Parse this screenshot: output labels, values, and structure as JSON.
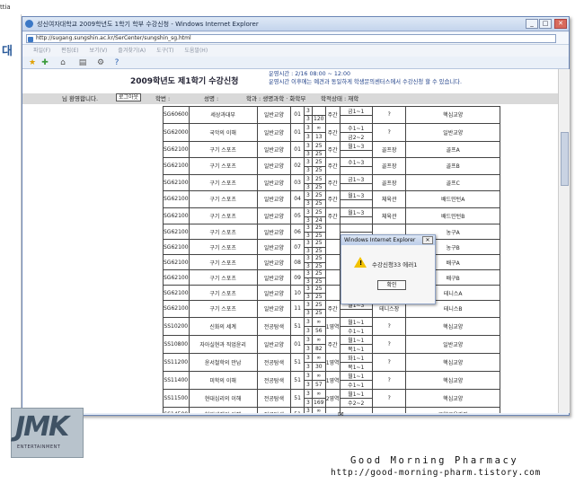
{
  "background_window": {
    "tab_fragment": "ttia",
    "side_char": "대"
  },
  "window": {
    "title": "성신여자대학교 2009학년도 1학기 학부 수강신청 - Windows Internet Explorer",
    "url": "http://sugang.sungshin.ac.kr/SerCenter/sungshin_sg.html",
    "menu": [
      "파일(F)",
      "편집(E)",
      "보기(V)",
      "즐겨찾기(A)",
      "도구(T)",
      "도움말(H)"
    ]
  },
  "page": {
    "title": "2009학년도 제1학기 수강신청",
    "info_line1": "운영시간 : 2/16 08:00 ~ 12:00",
    "info_line2": "운영시간 이후에는 예견과 동일하게 학생문의센터스에서 수강신청 할 수 있습니다.",
    "greeting": "님 환영합니다.",
    "logout": "로그아웃",
    "id_label": "학번 :",
    "name_label": "성명 :",
    "dept": "학과 : 생명과학 · 화학부",
    "status": "학적상태 : 재학"
  },
  "courses": [
    {
      "code": "SG60600",
      "name": "세상과대부",
      "type": "일반교양",
      "cls": "01",
      "nums": [
        "",
        "120"
      ],
      "day": "주간",
      "time": [
        "금1~1",
        ""
      ],
      "room": "?",
      "area": "핵심교양"
    },
    {
      "code": "SG62000",
      "name": "국악의 이해",
      "type": "일반교양",
      "cls": "01",
      "nums": [
        "∞",
        "13"
      ],
      "day": "주간",
      "time": [
        "수1~1",
        "금2~2"
      ],
      "room": "?",
      "area": "일반교양"
    },
    {
      "code": "SG62100",
      "name": "구기 스포츠",
      "type": "일반교양",
      "cls": "01",
      "nums": [
        "25",
        "25"
      ],
      "day": "주간",
      "time": [
        "월1~3",
        ""
      ],
      "room": "골프장",
      "area": "골프A"
    },
    {
      "code": "SG62100",
      "name": "구기 스포츠",
      "type": "일반교양",
      "cls": "02",
      "nums": [
        "25",
        "25"
      ],
      "day": "주간",
      "time": [
        "수1~3",
        ""
      ],
      "room": "골프장",
      "area": "골프B"
    },
    {
      "code": "SG62100",
      "name": "구기 스포츠",
      "type": "일반교양",
      "cls": "03",
      "nums": [
        "25",
        "25"
      ],
      "day": "주간",
      "time": [
        "금1~3",
        ""
      ],
      "room": "골프장",
      "area": "골프C"
    },
    {
      "code": "SG62100",
      "name": "구기 스포츠",
      "type": "일반교양",
      "cls": "04",
      "nums": [
        "25",
        "25"
      ],
      "day": "주간",
      "time": [
        "월1~3",
        ""
      ],
      "room": "체육관",
      "area": "배드민턴A"
    },
    {
      "code": "SG62100",
      "name": "구기 스포츠",
      "type": "일반교양",
      "cls": "05",
      "nums": [
        "25",
        "24"
      ],
      "day": "주간",
      "time": [
        "월1~3",
        ""
      ],
      "room": "체육관",
      "area": "배드민턴B"
    },
    {
      "code": "SG62100",
      "name": "구기 스포츠",
      "type": "일반교양",
      "cls": "06",
      "nums": [
        "25",
        "25"
      ],
      "day": "",
      "time": [
        "",
        ""
      ],
      "room": "",
      "area": "농구A"
    },
    {
      "code": "SG62100",
      "name": "구기 스포츠",
      "type": "일반교양",
      "cls": "07",
      "nums": [
        "25",
        "25"
      ],
      "day": "",
      "time": [
        "",
        ""
      ],
      "room": "",
      "area": "농구B"
    },
    {
      "code": "SG62100",
      "name": "구기 스포츠",
      "type": "일반교양",
      "cls": "08",
      "nums": [
        "25",
        "25"
      ],
      "day": "",
      "time": [
        "",
        ""
      ],
      "room": "",
      "area": "배구A"
    },
    {
      "code": "SG62100",
      "name": "구기 스포츠",
      "type": "일반교양",
      "cls": "09",
      "nums": [
        "25",
        "25"
      ],
      "day": "",
      "time": [
        "",
        ""
      ],
      "room": "",
      "area": "배구B"
    },
    {
      "code": "SG62100",
      "name": "구기 스포츠",
      "type": "일반교양",
      "cls": "10",
      "nums": [
        "25",
        "25"
      ],
      "day": "",
      "time": [
        "",
        ""
      ],
      "room": "",
      "area": "테니스A"
    },
    {
      "code": "SG62100",
      "name": "구기 스포츠",
      "type": "일반교양",
      "cls": "11",
      "nums": [
        "25",
        "25"
      ],
      "day": "주간",
      "time": [
        "월1~3",
        ""
      ],
      "room": "테니스장",
      "area": "테니스B"
    },
    {
      "code": "SS10200",
      "name": "신화의 세계",
      "type": "전공탐색",
      "cls": "51",
      "nums": [
        "∞",
        "56"
      ],
      "day": "1영역",
      "time": [
        "월1~1",
        "수1~1"
      ],
      "room": "?",
      "area": "핵심교양"
    },
    {
      "code": "SS10800",
      "name": "자아실현과 직업윤리",
      "type": "일반교양",
      "cls": "01",
      "nums": [
        "∞",
        "82"
      ],
      "day": "주간",
      "time": [
        "월1~1",
        "목1~1"
      ],
      "room": "?",
      "area": "일반교양"
    },
    {
      "code": "SS11200",
      "name": "윤서철학의 만남",
      "type": "전공탐색",
      "cls": "51",
      "nums": [
        "∞",
        "30"
      ],
      "day": "1영역",
      "time": [
        "화1~1",
        "목1~1"
      ],
      "room": "?",
      "area": "핵심교양"
    },
    {
      "code": "SS11400",
      "name": "미학의 이해",
      "type": "전공탐색",
      "cls": "51",
      "nums": [
        "∞",
        "57"
      ],
      "day": "1영역",
      "time": [
        "월1~1",
        "수1~1"
      ],
      "room": "?",
      "area": "핵심교양"
    },
    {
      "code": "SS11500",
      "name": "현대심리의 이해",
      "type": "전공탐색",
      "cls": "51",
      "nums": [
        "∞",
        "169"
      ],
      "day": "2영역",
      "time": [
        "월1~1",
        "수2~2"
      ],
      "room": "?",
      "area": "핵심교양"
    },
    {
      "code": "SS14500",
      "name": "현대세계의 이해",
      "type": "전공탐색",
      "cls": "51",
      "nums": [
        "∞",
        ""
      ],
      "day": "",
      "time": [
        "",
        ""
      ],
      "room": "",
      "area": "교양교육과정"
    }
  ],
  "credit_value": "3",
  "dialog": {
    "title": "Windows Internet Explorer",
    "message": "수강신청33 에러1",
    "ok": "확인"
  },
  "watermark": {
    "line1": "Good Morning Pharmacy",
    "line2": "http://good-morning-pharm.tistory.com"
  },
  "logo": {
    "big": "JMK",
    "small": "ENTERTAINMENT"
  },
  "colors": {
    "chrome": "#dfe9f6",
    "info_text": "#1e3f88",
    "grid_border": "#444444",
    "warning": "#f2c200"
  }
}
